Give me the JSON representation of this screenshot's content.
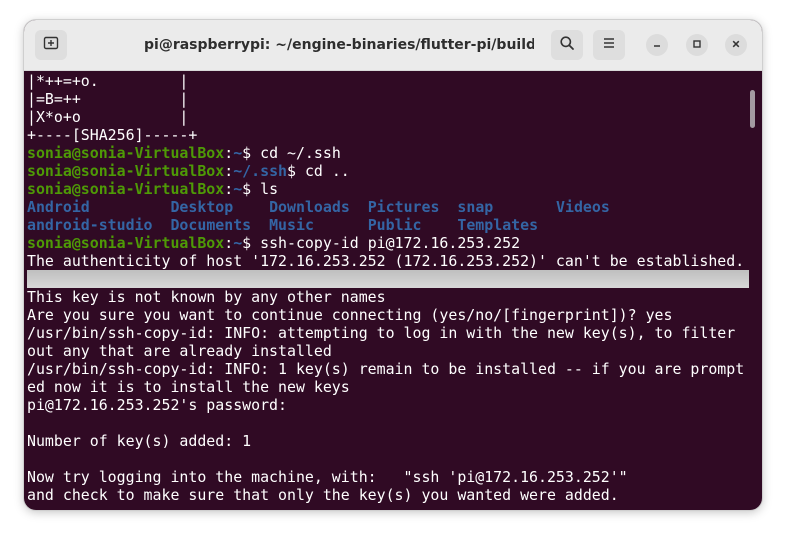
{
  "window": {
    "title": "pi@raspberrypi: ~/engine-binaries/flutter-pi/build"
  },
  "icons": {
    "new_tab": "new-tab-icon",
    "search": "search-icon",
    "menu": "hamburger-menu-icon",
    "minimize": "minimize-icon",
    "maximize": "maximize-icon",
    "close": "close-icon"
  },
  "colors": {
    "terminal_bg": "#300a24",
    "prompt_user": "#4e9a06",
    "prompt_path": "#3465a4",
    "directory": "#3465a4",
    "text": "#ffffff"
  },
  "terminal": {
    "art": [
      "|*++=+o.         |",
      "|=B=++           |",
      "|X*o+o           |",
      "+----[SHA256]-----+"
    ],
    "prompts": [
      {
        "user": "sonia@sonia-VirtualBox",
        "sep": ":",
        "path": "~",
        "sign": "$ ",
        "cmd": "cd ~/.ssh"
      },
      {
        "user": "sonia@sonia-VirtualBox",
        "sep": ":",
        "path": "~/.ssh",
        "sign": "$ ",
        "cmd": "cd .."
      },
      {
        "user": "sonia@sonia-VirtualBox",
        "sep": ":",
        "path": "~",
        "sign": "$ ",
        "cmd": "ls"
      },
      {
        "user": "sonia@sonia-VirtualBox",
        "sep": ":",
        "path": "~",
        "sign": "$ ",
        "cmd": "ssh-copy-id pi@172.16.253.252"
      }
    ],
    "ls_rows": [
      [
        "Android",
        "Desktop",
        "Downloads",
        "Pictures",
        "snap",
        "Videos"
      ],
      [
        "android-studio",
        "Documents",
        "Music",
        "Public",
        "Templates"
      ]
    ],
    "output": [
      "The authenticity of host '172.16.253.252 (172.16.253.252)' can't be established.",
      "This key is not known by any other names",
      "Are you sure you want to continue connecting (yes/no/[fingerprint])? yes",
      "/usr/bin/ssh-copy-id: INFO: attempting to log in with the new key(s), to filter",
      "out any that are already installed",
      "/usr/bin/ssh-copy-id: INFO: 1 key(s) remain to be installed -- if you are prompt",
      "ed now it is to install the new keys",
      "pi@172.16.253.252's password:",
      "Number of key(s) added: 1",
      "Now try logging into the machine, with:   \"ssh 'pi@172.16.253.252'\"",
      "and check to make sure that only the key(s) you wanted were added."
    ]
  }
}
